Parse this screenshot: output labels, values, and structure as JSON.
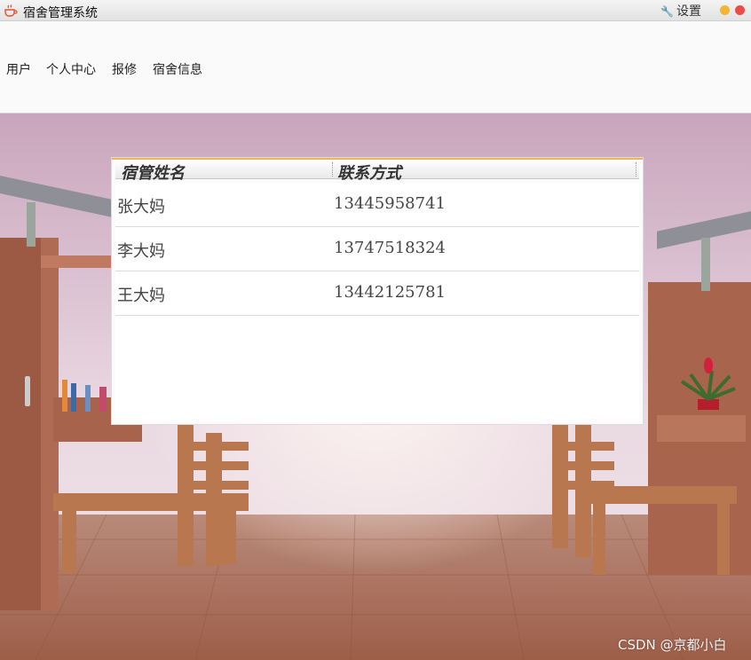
{
  "window": {
    "title": "宿舍管理系统",
    "settings_label": "设置"
  },
  "menu": {
    "items": [
      "用户",
      "个人中心",
      "报修",
      "宿舍信息"
    ]
  },
  "table": {
    "columns": [
      "宿管姓名",
      "联系方式"
    ],
    "rows": [
      {
        "name": "张大妈",
        "phone": "13445958741"
      },
      {
        "name": "李大妈",
        "phone": "13747518324"
      },
      {
        "name": "王大妈",
        "phone": "13442125781"
      }
    ]
  },
  "watermark": "CSDN @京都小白",
  "colors": {
    "accent_border": "#f0b458",
    "minimize": "#f2b632",
    "close": "#ec4b4b"
  },
  "icons": [
    "coffee-cup-icon",
    "wrench-icon",
    "minimize-icon",
    "close-icon"
  ]
}
